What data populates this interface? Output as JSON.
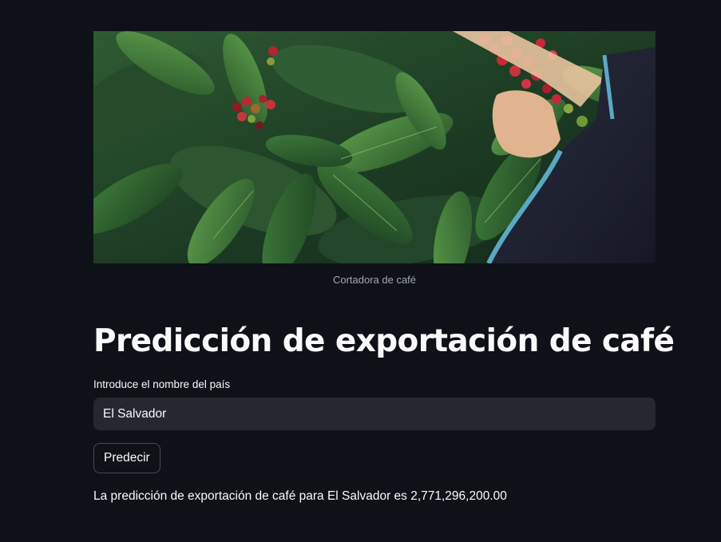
{
  "hero": {
    "image_name": "coffee-cherries-picking-photo",
    "caption": "Cortadora de café"
  },
  "page": {
    "title": "Predicción de exportación de café"
  },
  "form": {
    "country_label": "Introduce el nombre del país",
    "country_value": "El Salvador",
    "predict_label": "Predecir"
  },
  "result": {
    "text": "La predicción de exportación de café para El Salvador es 2,771,296,200.00"
  },
  "colors": {
    "background": "#0e1117",
    "input_background": "#262730",
    "text": "#fafafa",
    "caption": "#a3a8b4"
  }
}
